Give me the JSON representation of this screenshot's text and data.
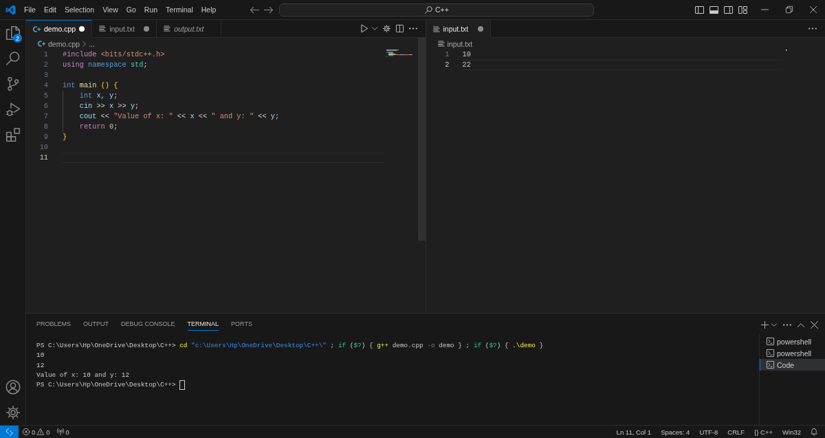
{
  "title_bar": {
    "menu": [
      "File",
      "Edit",
      "Selection",
      "View",
      "Go",
      "Run",
      "Terminal",
      "Help"
    ],
    "command_center": "C++",
    "layout_toggles": [
      {
        "kind": "primary-sidebar",
        "on": false
      },
      {
        "kind": "panel",
        "on": true
      },
      {
        "kind": "secondary-sidebar",
        "on": false
      }
    ]
  },
  "activity_bar": {
    "explorer_badge": "2"
  },
  "editor_groups": [
    {
      "focused": true,
      "tabs": [
        {
          "label": "demo.cpp",
          "kind": "cpp",
          "selected": true,
          "modified": true,
          "preview": false
        },
        {
          "label": "input.txt",
          "kind": "text",
          "selected": false,
          "modified": true,
          "preview": false
        },
        {
          "label": "output.txt",
          "kind": "text",
          "selected": false,
          "modified": false,
          "preview": true
        }
      ],
      "breadcrumb": [
        {
          "label": "demo.cpp",
          "kind": "cpp"
        },
        {
          "label": "...",
          "kind": "symbol"
        }
      ],
      "lines": [
        {
          "number": "1",
          "current": false,
          "tokens": [
            {
              "text": "#include ",
              "kind": "keyword"
            },
            {
              "text": "<bits/stdc++.h>",
              "kind": "string"
            }
          ]
        },
        {
          "number": "2",
          "current": false,
          "tokens": [
            {
              "text": "using ",
              "kind": "keyword"
            },
            {
              "text": "namespace ",
              "kind": "storage"
            },
            {
              "text": "std",
              "kind": "type"
            },
            {
              "text": ";",
              "kind": "plain"
            }
          ]
        },
        {
          "number": "3",
          "current": false
        },
        {
          "number": "4",
          "current": false,
          "tokens": [
            {
              "text": "int ",
              "kind": "storage"
            },
            {
              "text": "main ",
              "kind": "function"
            },
            {
              "text": "() {",
              "kind": "bracket"
            }
          ],
          "children": [
            {
              "number": "5",
              "current": false,
              "tokens": [
                {
                  "text": "int ",
                  "kind": "storage"
                },
                {
                  "text": "x",
                  "kind": "variable"
                },
                {
                  "text": ", ",
                  "kind": "plain"
                },
                {
                  "text": "y",
                  "kind": "variable"
                },
                {
                  "text": ";",
                  "kind": "plain"
                }
              ]
            },
            {
              "number": "6",
              "current": false,
              "tokens": [
                {
                  "text": "cin",
                  "kind": "variable"
                },
                {
                  "text": " >> ",
                  "kind": "plain"
                },
                {
                  "text": "x",
                  "kind": "variable"
                },
                {
                  "text": " >> ",
                  "kind": "plain"
                },
                {
                  "text": "y",
                  "kind": "variable"
                },
                {
                  "text": ";",
                  "kind": "plain"
                }
              ]
            },
            {
              "number": "7",
              "current": false,
              "tokens": [
                {
                  "text": "cout",
                  "kind": "variable"
                },
                {
                  "text": " << ",
                  "kind": "plain"
                },
                {
                  "text": "\"Value of x: \"",
                  "kind": "string"
                },
                {
                  "text": " << ",
                  "kind": "plain"
                },
                {
                  "text": "x",
                  "kind": "variable"
                },
                {
                  "text": " << ",
                  "kind": "plain"
                },
                {
                  "text": "\" and y: \"",
                  "kind": "string"
                },
                {
                  "text": " << ",
                  "kind": "plain"
                },
                {
                  "text": "y",
                  "kind": "variable"
                },
                {
                  "text": ";",
                  "kind": "plain"
                }
              ]
            },
            {
              "number": "8",
              "current": false,
              "tokens": [
                {
                  "text": "return ",
                  "kind": "keyword"
                },
                {
                  "text": "0",
                  "kind": "number"
                },
                {
                  "text": ";",
                  "kind": "plain"
                }
              ]
            }
          ]
        },
        {
          "number": "9",
          "current": false,
          "tokens": [
            {
              "text": "}",
              "kind": "bracket"
            }
          ]
        },
        {
          "number": "10",
          "current": false
        },
        {
          "number": "11",
          "current": true
        }
      ]
    },
    {
      "focused": false,
      "tabs": [
        {
          "label": "input.txt",
          "kind": "text",
          "selected": true,
          "modified": true,
          "preview": false
        }
      ],
      "breadcrumb": [
        {
          "label": "input.txt",
          "kind": "text"
        }
      ],
      "lines": [
        {
          "number": "1",
          "current": false,
          "tokens": [
            {
              "text": "10",
              "kind": "plain"
            }
          ]
        },
        {
          "number": "2",
          "current": true,
          "tokens": [
            {
              "text": "22",
              "kind": "plain"
            }
          ]
        }
      ]
    }
  ],
  "panel": {
    "tabs": [
      {
        "label": "PROBLEMS",
        "selected": false
      },
      {
        "label": "OUTPUT",
        "selected": false
      },
      {
        "label": "DEBUG CONSOLE",
        "selected": false
      },
      {
        "label": "TERMINAL",
        "selected": true
      },
      {
        "label": "PORTS",
        "selected": false
      }
    ],
    "terminal": {
      "lines": [
        {
          "cursor": false,
          "tokens": [
            {
              "text": "PS C:\\Users\\Hp\\OneDrive\\Desktop\\C++> ",
              "kind": "plain"
            },
            {
              "text": "cd ",
              "kind": "command"
            },
            {
              "text": "\"c:\\Users\\Hp\\OneDrive\\Desktop\\C++\\\"",
              "kind": "string"
            },
            {
              "text": " ; ",
              "kind": "plain"
            },
            {
              "text": "if",
              "kind": "keyword"
            },
            {
              "text": " (",
              "kind": "plain"
            },
            {
              "text": "$?",
              "kind": "variable"
            },
            {
              "text": ") { ",
              "kind": "plain"
            },
            {
              "text": "g++",
              "kind": "command"
            },
            {
              "text": " demo.cpp ",
              "kind": "plain"
            },
            {
              "text": "-o",
              "kind": "parameter"
            },
            {
              "text": " demo } ; ",
              "kind": "plain"
            },
            {
              "text": "if",
              "kind": "keyword"
            },
            {
              "text": " (",
              "kind": "plain"
            },
            {
              "text": "$?",
              "kind": "variable"
            },
            {
              "text": ") { ",
              "kind": "plain"
            },
            {
              "text": ".\\demo",
              "kind": "command"
            },
            {
              "text": " }",
              "kind": "plain"
            }
          ]
        },
        {
          "cursor": false,
          "tokens": [
            {
              "text": "10",
              "kind": "plain"
            }
          ]
        },
        {
          "cursor": false,
          "tokens": [
            {
              "text": "12",
              "kind": "plain"
            }
          ]
        },
        {
          "cursor": false,
          "tokens": [
            {
              "text": "Value of x: 10 and y: 12",
              "kind": "plain"
            }
          ]
        },
        {
          "cursor": true,
          "tokens": [
            {
              "text": "PS C:\\Users\\Hp\\OneDrive\\Desktop\\C++> ",
              "kind": "plain"
            }
          ]
        }
      ]
    },
    "terminal_instances": [
      {
        "label": "powershell",
        "selected": false
      },
      {
        "label": "powershell",
        "selected": false
      },
      {
        "label": "Code",
        "selected": true
      }
    ]
  },
  "status_bar": {
    "errors": "0",
    "warnings": "0",
    "ports": "0",
    "items": [
      "Ln 11, Col 1",
      "Spaces: 4",
      "UTF-8",
      "CRLF",
      "{} C++",
      "Win32"
    ]
  }
}
